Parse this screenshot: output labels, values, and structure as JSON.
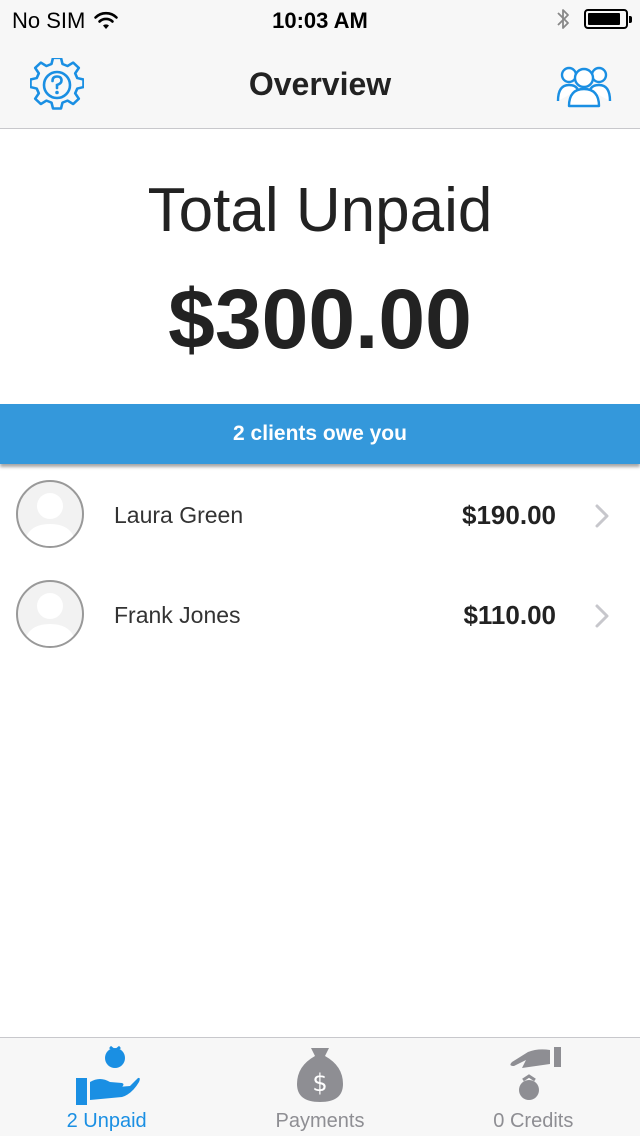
{
  "status_bar": {
    "carrier": "No SIM",
    "time": "10:03 AM",
    "battery_level": 0.9
  },
  "nav": {
    "title": "Overview",
    "left_icon": "gear-help-icon",
    "right_icon": "clients-group-icon"
  },
  "summary": {
    "label": "Total Unpaid",
    "amount": "$300.00"
  },
  "banner": {
    "text": "2 clients owe you"
  },
  "clients": [
    {
      "name": "Laura Green",
      "amount": "$190.00"
    },
    {
      "name": "Frank Jones",
      "amount": "$110.00"
    }
  ],
  "tabs": [
    {
      "label": "2 Unpaid",
      "icon": "hand-receive-money-icon",
      "active": true
    },
    {
      "label": "Payments",
      "icon": "money-bag-icon",
      "active": false
    },
    {
      "label": "0 Credits",
      "icon": "hand-give-money-icon",
      "active": false
    }
  ],
  "colors": {
    "accent": "#1a8fe3",
    "banner": "#3498db",
    "inactive": "#8e8e93"
  }
}
